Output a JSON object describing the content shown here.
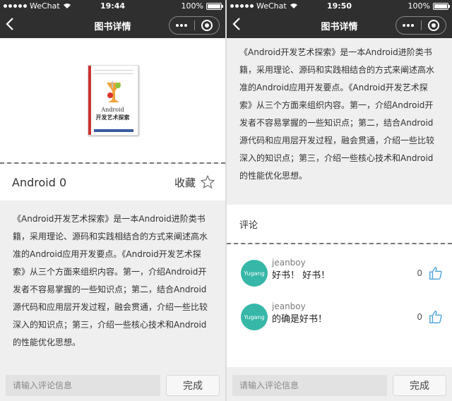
{
  "status_bar": {
    "carrier": "WeChat",
    "battery": "100%",
    "battery_level": 1.0
  },
  "screens": [
    {
      "time": "19:44",
      "nav_title": "图书详情",
      "cover": {
        "title_line1": "Android",
        "title_line2": "开发艺术探索"
      },
      "book_name": "Android 0",
      "favorite_label": "收藏",
      "description": "《Android开发艺术探索》是一本Android进阶类书籍，采用理论、源码和实践相结合的方式来阐述高水准的Android应用开发要点。《Android开发艺术探索》从三个方面来组织内容。第一，介绍Android开发者不容易掌握的一些知识点；第二，结合Android源代码和应用层开发过程，融会贯通，介绍一些比较深入的知识点；第三，介绍一些核心技术和Android的性能优化思想。",
      "comment_input": {
        "placeholder": "请输入评论信息"
      },
      "submit_label": "完成"
    },
    {
      "time": "19:50",
      "nav_title": "图书详情",
      "description": "《Android开发艺术探索》是一本Android进阶类书籍，采用理论、源码和实践相结合的方式来阐述高水准的Android应用开发要点。《Android开发艺术探索》从三个方面来组织内容。第一，介绍Android开发者不容易掌握的一些知识点；第二，结合Android源代码和应用层开发过程，融会贯通，介绍一些比较深入的知识点；第三，介绍一些核心技术和Android的性能优化思想。",
      "comments_title": "评论",
      "comments": [
        {
          "user": "jeanboy",
          "avatar_text": "Yugang",
          "text": "好书！ 好书！",
          "likes": "0"
        },
        {
          "user": "jeanboy",
          "avatar_text": "Yugang",
          "text": "的确是好书！",
          "likes": "0"
        }
      ],
      "comment_input": {
        "placeholder": "请输入评论信息"
      },
      "submit_label": "完成"
    }
  ],
  "colors": {
    "nav_bg": "#2f2f30",
    "accent_teal": "#36b7a7",
    "like_icon": "#4aa3d8"
  },
  "icons": [
    "back-chevron-icon",
    "more-dots-icon",
    "close-target-icon",
    "star-outline-icon",
    "thumbs-up-icon",
    "signal-dots-icon",
    "wifi-icon",
    "battery-icon"
  ]
}
